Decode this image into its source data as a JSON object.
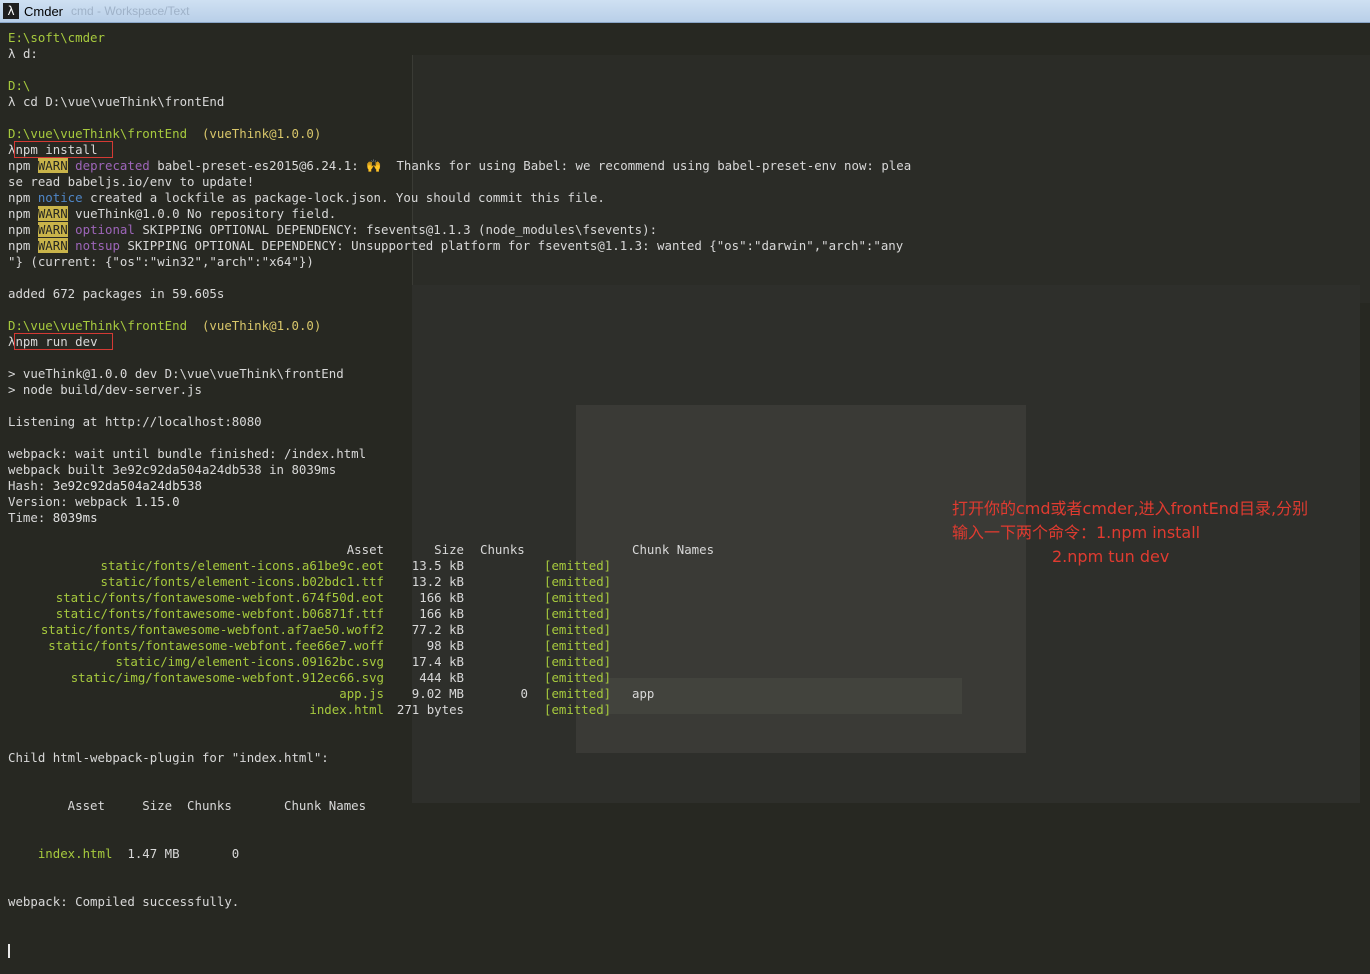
{
  "window": {
    "title": "Cmder",
    "ghost_title": "cmd - Workspace/Text"
  },
  "terminal": {
    "lines": [
      {
        "k": "cwd",
        "text": "E:\\soft\\cmder"
      },
      {
        "k": "cmd",
        "prompt": "λ",
        "text": "d:"
      },
      {
        "k": "blank"
      },
      {
        "k": "cwd",
        "text": "D:\\"
      },
      {
        "k": "cmd",
        "prompt": "λ",
        "text": "cd D:\\vue\\vueThink\\frontEnd"
      },
      {
        "k": "blank"
      },
      {
        "k": "cwd2",
        "text": "D:\\vue\\vueThink\\frontEnd",
        "pkg": "(vueThink@1.0.0)"
      },
      {
        "k": "cmdbox",
        "prompt": "λ",
        "text": "npm install"
      },
      {
        "k": "npm",
        "level": "WARN",
        "tag": "deprecated",
        "tagc": "magenta",
        "rest": "babel-preset-es2015@6.24.1: 🙌  Thanks for using Babel: we recommend using babel-preset-env now: plea"
      },
      {
        "k": "plain",
        "text": "se read babeljs.io/env to update!"
      },
      {
        "k": "npm",
        "level": "notice",
        "tag": "",
        "rest": "created a lockfile as package-lock.json. You should commit this file."
      },
      {
        "k": "npm",
        "level": "WARN",
        "tag": "",
        "rest": "vueThink@1.0.0 No repository field."
      },
      {
        "k": "npm",
        "level": "WARN",
        "tag": "optional",
        "tagc": "magenta",
        "rest": "SKIPPING OPTIONAL DEPENDENCY: fsevents@1.1.3 (node_modules\\fsevents):"
      },
      {
        "k": "npm",
        "level": "WARN",
        "tag": "notsup",
        "tagc": "magenta",
        "rest": "SKIPPING OPTIONAL DEPENDENCY: Unsupported platform for fsevents@1.1.3: wanted {\"os\":\"darwin\",\"arch\":\"any"
      },
      {
        "k": "plain",
        "text": "\"} (current: {\"os\":\"win32\",\"arch\":\"x64\"})"
      },
      {
        "k": "blank"
      },
      {
        "k": "plain",
        "text": "added 672 packages in 59.605s"
      },
      {
        "k": "blank"
      },
      {
        "k": "cwd2",
        "text": "D:\\vue\\vueThink\\frontEnd",
        "pkg": "(vueThink@1.0.0)"
      },
      {
        "k": "cmdbox",
        "prompt": "λ",
        "text": "npm run dev"
      },
      {
        "k": "blank"
      },
      {
        "k": "plain",
        "text": "> vueThink@1.0.0 dev D:\\vue\\vueThink\\frontEnd"
      },
      {
        "k": "plain",
        "text": "> node build/dev-server.js"
      },
      {
        "k": "blank"
      },
      {
        "k": "plain",
        "text": "Listening at http://localhost:8080"
      },
      {
        "k": "blank"
      },
      {
        "k": "plain",
        "text": "webpack: wait until bundle finished: /index.html"
      },
      {
        "k": "plain",
        "text": "webpack built 3e92c92da504a24db538 in 8039ms"
      },
      {
        "k": "hash",
        "label": "Hash: ",
        "value": "3e92c92da504a24db538"
      },
      {
        "k": "hash",
        "label": "Version: webpack ",
        "value": "1.15.0"
      },
      {
        "k": "hash",
        "label": "Time: ",
        "value": "8039ms"
      }
    ],
    "table": {
      "headers": {
        "asset": "Asset",
        "size": "Size",
        "chunks": "Chunks",
        "names": "Chunk Names"
      },
      "rows": [
        {
          "asset": "static/fonts/element-icons.a61be9c.eot",
          "size": "13.5 kB",
          "chunks": "",
          "emitted": "[emitted]",
          "names": ""
        },
        {
          "asset": "static/fonts/element-icons.b02bdc1.ttf",
          "size": "13.2 kB",
          "chunks": "",
          "emitted": "[emitted]",
          "names": ""
        },
        {
          "asset": "static/fonts/fontawesome-webfont.674f50d.eot",
          "size": "166 kB",
          "chunks": "",
          "emitted": "[emitted]",
          "names": ""
        },
        {
          "asset": "static/fonts/fontawesome-webfont.b06871f.ttf",
          "size": "166 kB",
          "chunks": "",
          "emitted": "[emitted]",
          "names": ""
        },
        {
          "asset": "static/fonts/fontawesome-webfont.af7ae50.woff2",
          "size": "77.2 kB",
          "chunks": "",
          "emitted": "[emitted]",
          "names": ""
        },
        {
          "asset": "static/fonts/fontawesome-webfont.fee66e7.woff",
          "size": "98 kB",
          "chunks": "",
          "emitted": "[emitted]",
          "names": ""
        },
        {
          "asset": "static/img/element-icons.09162bc.svg",
          "size": "17.4 kB",
          "chunks": "",
          "emitted": "[emitted]",
          "names": ""
        },
        {
          "asset": "static/img/fontawesome-webfont.912ec66.svg",
          "size": "444 kB",
          "chunks": "",
          "emitted": "[emitted]",
          "names": ""
        },
        {
          "asset": "app.js",
          "size": "9.02 MB",
          "chunks": "0",
          "emitted": "[emitted]",
          "names": "app"
        },
        {
          "asset": "index.html",
          "size": "271 bytes",
          "chunks": "",
          "emitted": "[emitted]",
          "names": ""
        }
      ]
    },
    "child_header": "Child html-webpack-plugin for \"index.html\":",
    "child_cols": "        Asset     Size  Chunks       Chunk Names",
    "child_row": {
      "asset": "index.html",
      "rest": "  1.47 MB       0"
    },
    "compiled": "webpack: Compiled successfully."
  },
  "annotation": {
    "line1": "打开你的cmd或者cmder,进入frontEnd目录,分别",
    "line2": "输入一下两个命令：1.npm install",
    "line3": "2.npm tun dev"
  },
  "colors": {
    "bg": "#272822",
    "green": "#a6c93d",
    "warn_bg": "#c9b44a",
    "magenta": "#9d65b9",
    "notice": "#4f86c6",
    "annotation": "#e03b30",
    "box": "#d43a34"
  }
}
